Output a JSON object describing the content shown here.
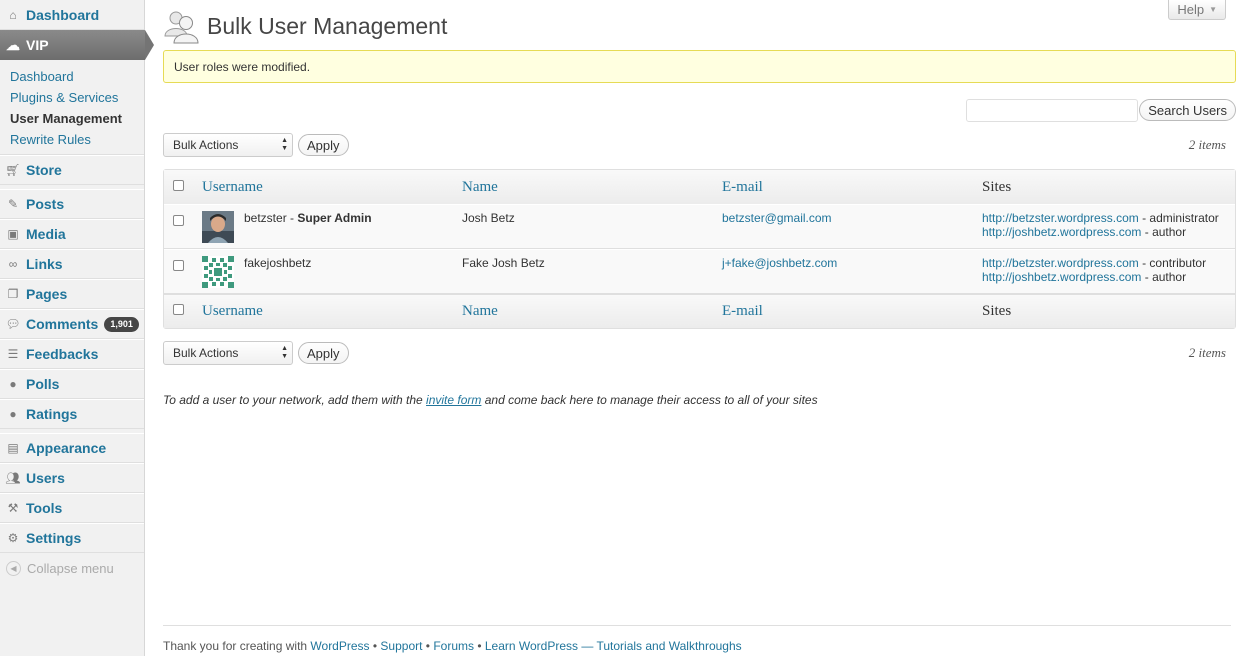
{
  "sidebar": {
    "top_item": {
      "label": "Dashboard",
      "icon": "home-icon"
    },
    "vip": {
      "label": "VIP",
      "icon": "cloud-icon"
    },
    "submenu": [
      {
        "label": "Dashboard"
      },
      {
        "label": "Plugins & Services"
      },
      {
        "label": "User Management"
      },
      {
        "label": "Rewrite Rules"
      }
    ],
    "items": [
      {
        "label": "Store",
        "icon": "cart-icon"
      },
      {
        "label": "Posts",
        "icon": "pin-icon"
      },
      {
        "label": "Media",
        "icon": "media-icon"
      },
      {
        "label": "Links",
        "icon": "link-icon"
      },
      {
        "label": "Pages",
        "icon": "pages-icon"
      },
      {
        "label": "Comments",
        "icon": "comment-icon",
        "badge": "1,901"
      },
      {
        "label": "Feedbacks",
        "icon": "feedback-icon"
      },
      {
        "label": "Polls",
        "icon": "poll-icon"
      },
      {
        "label": "Ratings",
        "icon": "rating-icon"
      },
      {
        "label": "Appearance",
        "icon": "appearance-icon"
      },
      {
        "label": "Users",
        "icon": "users-icon"
      },
      {
        "label": "Tools",
        "icon": "tools-icon"
      },
      {
        "label": "Settings",
        "icon": "settings-icon"
      }
    ],
    "collapse_label": "Collapse menu"
  },
  "header": {
    "title": "Bulk User Management",
    "help_label": "Help"
  },
  "notice": "User roles were modified.",
  "search": {
    "button_label": "Search Users",
    "value": ""
  },
  "tablenav": {
    "bulk_label": "Bulk Actions",
    "apply_label": "Apply",
    "items_count": "2 items"
  },
  "table": {
    "columns": [
      "Username",
      "Name",
      "E-mail",
      "Sites"
    ],
    "rows": [
      {
        "username": "betzster",
        "role_suffix": " - ",
        "super_label": "Super Admin",
        "name": "Josh Betz",
        "email": "betzster@gmail.com",
        "sites": [
          {
            "url": "http://betzster.wordpress.com",
            "role": " - administrator"
          },
          {
            "url": "http://joshbetz.wordpress.com",
            "role": " - author"
          }
        ]
      },
      {
        "username": "fakejoshbetz",
        "role_suffix": "",
        "super_label": "",
        "name": "Fake Josh Betz",
        "email": "j+fake@joshbetz.com",
        "sites": [
          {
            "url": "http://betzster.wordpress.com",
            "role": " - contributor"
          },
          {
            "url": "http://joshbetz.wordpress.com",
            "role": " - author"
          }
        ]
      }
    ]
  },
  "invite": {
    "before": "To add a user to your network, add them with the ",
    "link": "invite form",
    "after": " and come back here to manage their access to all of your sites"
  },
  "footer": {
    "prefix": "Thank you for creating with ",
    "wordpress": "WordPress",
    "sep1": " • ",
    "support": "Support",
    "sep2": " • ",
    "forums": "Forums",
    "sep3": " • ",
    "learn": "Learn WordPress — Tutorials and Walkthroughs"
  }
}
